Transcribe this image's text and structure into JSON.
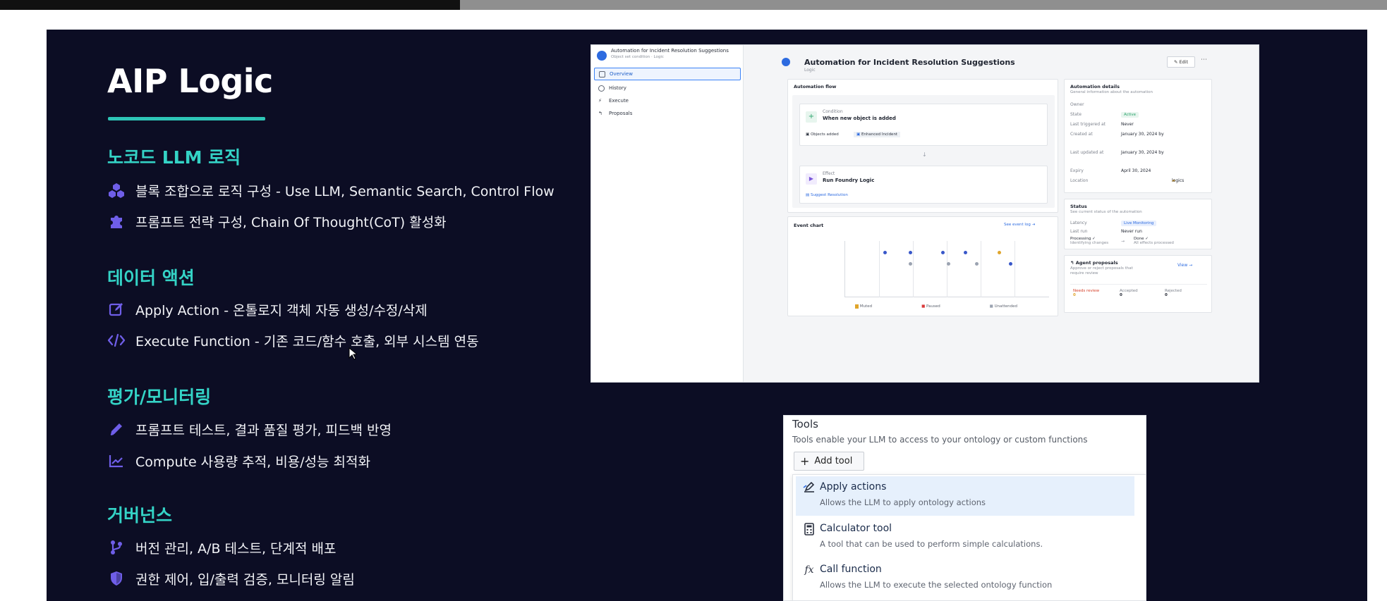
{
  "slide": {
    "title": "AIP Logic",
    "sections": [
      {
        "heading": "노코드 LLM 로직",
        "items": [
          {
            "icon": "blocks-icon",
            "text": "블록 조합으로 로직 구성 - Use LLM, Semantic Search, Control Flow"
          },
          {
            "icon": "puzzle-icon",
            "text": "프롬프트 전략 구성, Chain Of Thought(CoT) 활성화"
          }
        ]
      },
      {
        "heading": "데이터 액션",
        "items": [
          {
            "icon": "edit-icon",
            "text": "Apply Action - 온톨로지 객체 자동 생성/수정/삭제"
          },
          {
            "icon": "code-icon",
            "text": "Execute Function - 기존 코드/함수 호출, 외부 시스템 연동"
          }
        ]
      },
      {
        "heading": "평가/모니터링",
        "items": [
          {
            "icon": "pen-icon",
            "text": "프롬프트 테스트, 결과 품질 평가, 피드백 반영"
          },
          {
            "icon": "chart-line-icon",
            "text": "Compute 사용량 추적, 비용/성능 최적화"
          }
        ]
      },
      {
        "heading": "거버넌스",
        "items": [
          {
            "icon": "branch-icon",
            "text": "버전 관리, A/B 테스트, 단계적 배포"
          },
          {
            "icon": "shield-icon",
            "text": "권한 제어, 입/출력 검증, 모니터링 알림"
          }
        ]
      }
    ]
  },
  "automation": {
    "sidebar_title": "Automation for Incident Resolution Suggestions",
    "sidebar_sub": "Object set condition · Logic",
    "nav": [
      "Overview",
      "History",
      "Execute",
      "Proposals"
    ],
    "title": "Automation for Incident Resolution Suggestions",
    "subtitle": "Logic",
    "edit": "Edit",
    "flow_title": "Automation flow",
    "condition_label": "Condition",
    "condition_value": "When new object is added",
    "object_added": "Objects added",
    "enhanced_incident": "Enhanced Incident",
    "effect_label": "Effect",
    "effect_value": "Run Foundry Logic",
    "suggest": "Suggest Resolution",
    "event_chart": "Event chart",
    "event_log": "See event log",
    "legend": [
      "Muted",
      "Paused",
      "Unattended"
    ],
    "details_title": "Automation details",
    "details_sub": "General information about the automation",
    "details": [
      {
        "k": "Owner",
        "v": ""
      },
      {
        "k": "State",
        "v": "Active"
      },
      {
        "k": "Last triggered at",
        "v": "Never"
      },
      {
        "k": "Created at",
        "v": "January 30, 2024 by"
      },
      {
        "k": "Last updated at",
        "v": "January 30, 2024 by"
      },
      {
        "k": "Expiry",
        "v": "April 30, 2024"
      },
      {
        "k": "Location",
        "v": "logics"
      }
    ],
    "status_title": "Status",
    "status_sub": "See current status of the automation",
    "latency_k": "Latency",
    "latency_v": "Live Monitoring",
    "lastrun_k": "Last run",
    "lastrun_v": "Never run",
    "processing": "Processing",
    "processing_sub": "Identifying changes",
    "done": "Done",
    "done_sub": "All effects processed",
    "proposals_title": "Agent proposals",
    "proposals_sub": "Approve or reject proposals that require review",
    "view": "View",
    "prop_cols": [
      "Needs review",
      "Accepted",
      "Rejected"
    ],
    "prop_vals": [
      "0",
      "0",
      "0"
    ]
  },
  "tools": {
    "title": "Tools",
    "desc": "Tools enable your LLM to access to your ontology or custom functions",
    "add_label": "Add tool",
    "options": [
      {
        "icon": "apply-actions-icon",
        "name": "Apply actions",
        "desc": "Allows the LLM to apply ontology actions",
        "selected": true
      },
      {
        "icon": "calculator-icon",
        "name": "Calculator tool",
        "desc": "A tool that can be used to perform simple calculations.",
        "selected": false
      },
      {
        "icon": "function-icon",
        "name": "Call function",
        "desc": "Allows the LLM to execute the selected ontology function",
        "selected": false
      }
    ]
  },
  "colors": {
    "slide_bg": "#0c0d24",
    "accent": "#34d3c6",
    "icon": "#6f5ee8",
    "selection": "#e6f0fc"
  }
}
